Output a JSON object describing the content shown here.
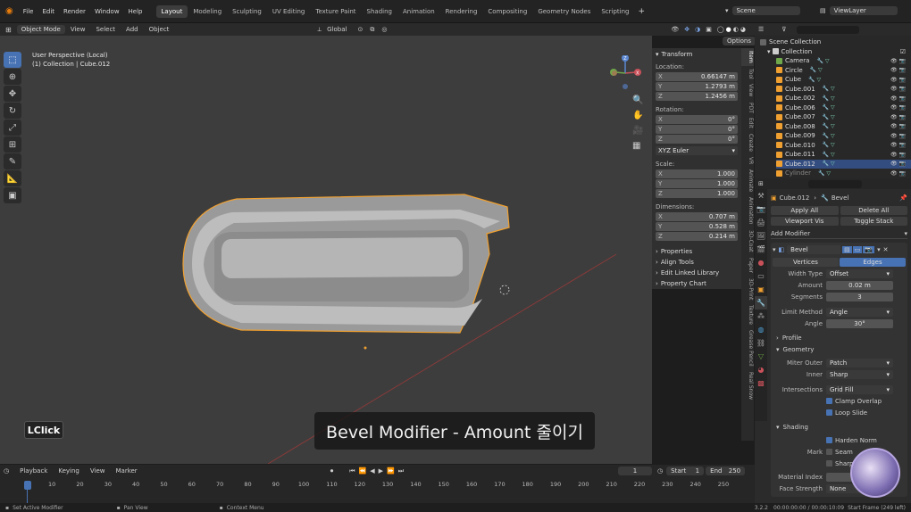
{
  "topbar": {
    "menus": [
      "File",
      "Edit",
      "Render",
      "Window",
      "Help"
    ],
    "workspaces": [
      "Layout",
      "Modeling",
      "Sculpting",
      "UV Editing",
      "Texture Paint",
      "Shading",
      "Animation",
      "Rendering",
      "Compositing",
      "Geometry Nodes",
      "Scripting"
    ],
    "active_workspace": "Layout",
    "scene": "Scene",
    "view_layer": "ViewLayer"
  },
  "viewport_header": {
    "mode": "Object Mode",
    "menus": [
      "View",
      "Select",
      "Add",
      "Object"
    ],
    "orientation": "Global",
    "options": "Options"
  },
  "viewport": {
    "view_name": "User Perspective (Local)",
    "collection_info": "(1) Collection | Cube.012",
    "gizmo_axes": [
      "X",
      "Y",
      "Z"
    ]
  },
  "npanel": {
    "transform": "Transform",
    "location_label": "Location:",
    "location": [
      {
        "k": "X",
        "v": "0.66147 m"
      },
      {
        "k": "Y",
        "v": "1.2793 m"
      },
      {
        "k": "Z",
        "v": "1.2456 m"
      }
    ],
    "rotation_label": "Rotation:",
    "rotation": [
      {
        "k": "X",
        "v": "0°"
      },
      {
        "k": "Y",
        "v": "0°"
      },
      {
        "k": "Z",
        "v": "0°"
      }
    ],
    "rotation_mode": "XYZ Euler",
    "scale_label": "Scale:",
    "scale": [
      {
        "k": "X",
        "v": "1.000"
      },
      {
        "k": "Y",
        "v": "1.000"
      },
      {
        "k": "Z",
        "v": "1.000"
      }
    ],
    "dimensions_label": "Dimensions:",
    "dimensions": [
      {
        "k": "X",
        "v": "0.707 m"
      },
      {
        "k": "Y",
        "v": "0.528 m"
      },
      {
        "k": "Z",
        "v": "0.214 m"
      }
    ],
    "sections": [
      "Properties",
      "Align Tools",
      "Edit Linked Library",
      "Property Chart"
    ]
  },
  "side_tabs": [
    "Item",
    "Tool",
    "View",
    "PDT",
    "Edit",
    "Create",
    "VR",
    "Animate",
    "Animation",
    "3D-Coat",
    "Paper",
    "3D-Print",
    "Texture",
    "Grease Pencil",
    "Real Snow"
  ],
  "outliner": {
    "root": "Scene Collection",
    "collection": "Collection",
    "items": [
      "Camera",
      "Circle",
      "Cube",
      "Cube.001",
      "Cube.002",
      "Cube.006",
      "Cube.007",
      "Cube.008",
      "Cube.009",
      "Cube.010",
      "Cube.011",
      "Cube.012",
      "Cylinder"
    ],
    "selected": "Cube.012"
  },
  "properties": {
    "object": "Cube.012",
    "modifier": "Bevel",
    "apply_all": "Apply All",
    "delete_all": "Delete All",
    "viewport_vis": "Viewport Vis",
    "toggle_stack": "Toggle Stack",
    "add_modifier": "Add Modifier",
    "modifier_name": "Bevel",
    "tab_vertices": "Vertices",
    "tab_edges": "Edges",
    "width_type_label": "Width Type",
    "width_type": "Offset",
    "amount_label": "Amount",
    "amount": "0.02 m",
    "segments_label": "Segments",
    "segments": "3",
    "limit_method_label": "Limit Method",
    "limit_method": "Angle",
    "angle_label": "Angle",
    "angle": "30°",
    "profile": "Profile",
    "geometry": "Geometry",
    "miter_outer_label": "Miter Outer",
    "miter_outer": "Patch",
    "inner_label": "Inner",
    "inner": "Sharp",
    "intersections_label": "Intersections",
    "intersections": "Grid Fill",
    "clamp_overlap": "Clamp Overlap",
    "loop_slide": "Loop Slide",
    "shading": "Shading",
    "harden_normals": "Harden Norm",
    "mark_label": "Mark",
    "seam": "Seam",
    "sharp": "Sharp",
    "material_index_label": "Material Index",
    "face_strength_label": "Face Strength",
    "face_strength": "None"
  },
  "timeline": {
    "menus": [
      "Playback",
      "Keying",
      "View",
      "Marker"
    ],
    "current_frame": "1",
    "start_label": "Start",
    "start": "1",
    "end_label": "End",
    "end": "250",
    "ticks": [
      "1",
      "10",
      "20",
      "30",
      "40",
      "50",
      "60",
      "70",
      "80",
      "90",
      "100",
      "110",
      "120",
      "130",
      "140",
      "150",
      "160",
      "170",
      "180",
      "190",
      "200",
      "210",
      "220",
      "230",
      "240",
      "250"
    ]
  },
  "statusbar": {
    "left": "Set Active Modifier",
    "middle": "Pan View",
    "right": "Context Menu",
    "version": "3.2.2",
    "timecode": "00:00:00:00 / 00:00:10:09",
    "frame_info": "Start Frame (249 left)"
  },
  "overlay": {
    "subtitle": "Bevel Modifier - Amount 줄이기",
    "key": "LClick"
  },
  "colors": {
    "accent": "#4772b3",
    "selection_outline": "#f0a030",
    "background": "#3d3d3d"
  }
}
